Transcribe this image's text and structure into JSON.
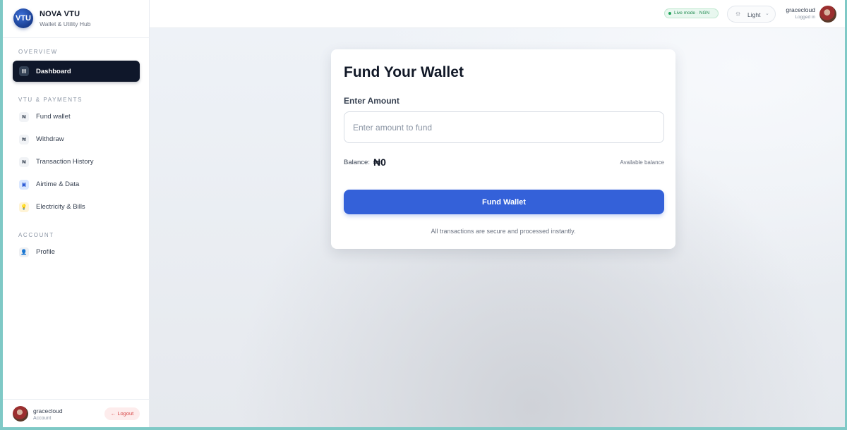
{
  "brand": {
    "logo_text": "VTU",
    "name": "NOVA VTU",
    "subtitle": "Wallet & Utility Hub"
  },
  "sidebar": {
    "sections": [
      {
        "label": "OVERVIEW"
      },
      {
        "label": "VTU & PAYMENTS"
      },
      {
        "label": "ACCOUNT"
      }
    ],
    "items": [
      {
        "label": "Dashboard",
        "icon": "▤",
        "icon_name": "dashboard-icon",
        "active": true
      },
      {
        "label": "Fund wallet",
        "icon": "₦",
        "icon_name": "naira-icon"
      },
      {
        "label": "Withdraw",
        "icon": "₦",
        "icon_name": "naira-icon"
      },
      {
        "label": "Transaction History",
        "icon": "₦",
        "icon_name": "naira-icon"
      },
      {
        "label": "Airtime & Data",
        "icon": "▣",
        "icon_name": "phone-icon"
      },
      {
        "label": "Electricity & Bills",
        "icon": "💡",
        "icon_name": "bulb-icon"
      },
      {
        "label": "Profile",
        "icon": "👤",
        "icon_name": "user-icon"
      }
    ],
    "footer": {
      "name": "gracecloud",
      "role": "Account",
      "logout_label": "← Logout"
    }
  },
  "topbar": {
    "live_badge": "Live mode · NGN",
    "theme_label": "Light",
    "theme_icon": "☼",
    "chevron": "⌄",
    "user_name": "gracecloud",
    "user_status": "Logged in"
  },
  "card": {
    "title": "Fund Your Wallet",
    "amount_label": "Enter Amount",
    "amount_placeholder": "Enter amount to fund",
    "amount_value": "",
    "balance_label": "Balance:",
    "balance_value": "₦0",
    "balance_hint": "Available balance",
    "button_label": "Fund Wallet",
    "note": "All transactions are secure and processed instantly."
  },
  "colors": {
    "accent": "#3461d9",
    "sidebar_active": "#0f172a",
    "live_green": "#22a55b",
    "logout_red": "#d64545"
  }
}
